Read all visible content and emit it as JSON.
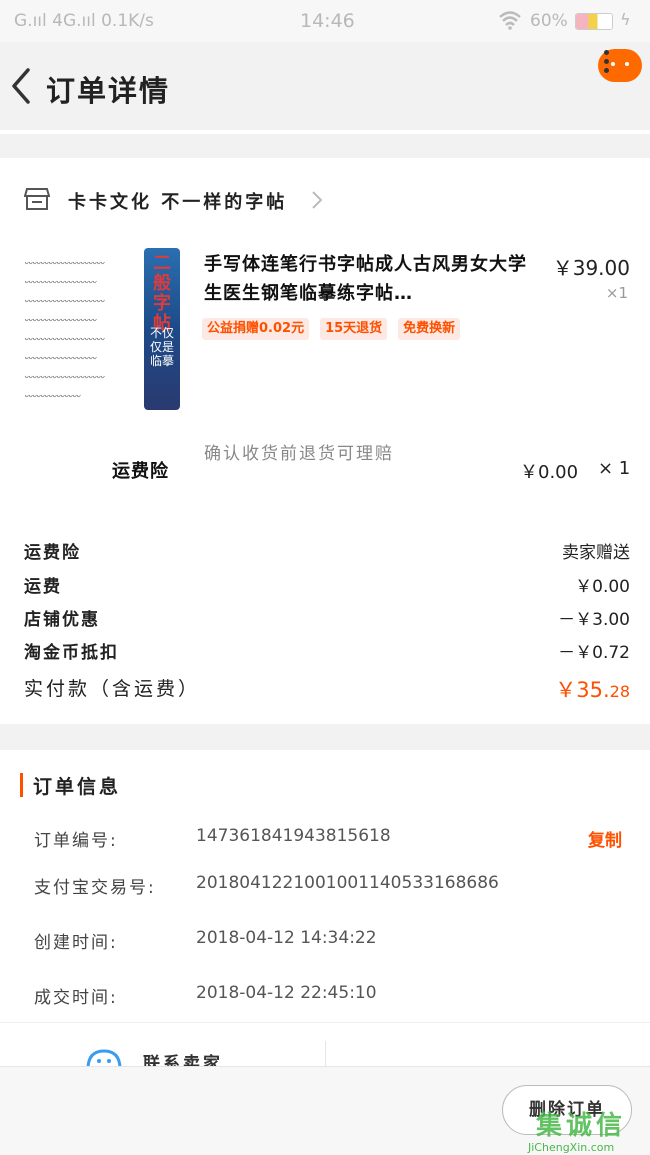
{
  "status_bar": {
    "signal": "G.ııl  4G.ııl  0.1K/s",
    "time": "14:46",
    "battery": "60%",
    "battery_level": 0.6
  },
  "nav": {
    "title": "订单详情"
  },
  "shop": {
    "name": "卡卡文化 不一样的字帖"
  },
  "product": {
    "title": "手写体连笔行书字帖成人古风男女大学生医生钢笔临摹练字帖…",
    "price": "￥39.00",
    "qty": "×1",
    "image_banner_red": "二般字帖",
    "image_banner_white": "不仅仅是临摹",
    "tags": [
      "公益捐赠0.02元",
      "15天退货",
      "免费换新"
    ]
  },
  "insurance": {
    "label": "运费险",
    "desc": "确认收货前退货可理赔",
    "price": "￥0.00",
    "qty": "× 1"
  },
  "summary": [
    {
      "key": "运费险",
      "value": "卖家赠送"
    },
    {
      "key": "运费",
      "value": "￥0.00"
    },
    {
      "key": "店铺优惠",
      "value": "－￥3.00"
    },
    {
      "key": "淘金币抵扣",
      "value": "－￥0.72"
    }
  ],
  "total": {
    "label": "实付款（含运费）",
    "value_main": "￥35.",
    "value_cents": "28"
  },
  "order_info": {
    "title": "订单信息",
    "copy_label": "复制",
    "rows": [
      {
        "key": "订单编号:",
        "value": "147361841943815618"
      },
      {
        "key": "支付宝交易号:",
        "value": "2018041221001001140533168686"
      },
      {
        "key": "创建时间:",
        "value": "2018-04-12 14:34:22"
      },
      {
        "key": "成交时间:",
        "value": "2018-04-12 22:45:10"
      }
    ]
  },
  "contact": {
    "label": "联系卖家"
  },
  "bottom": {
    "delete_label": "删除订单"
  },
  "watermark": {
    "logo": "集诚信",
    "url": "JiChengXin.com"
  },
  "colors": {
    "accent": "#ff5000",
    "tag_bg": "#fde9e3",
    "badge": "#ff6a00"
  }
}
